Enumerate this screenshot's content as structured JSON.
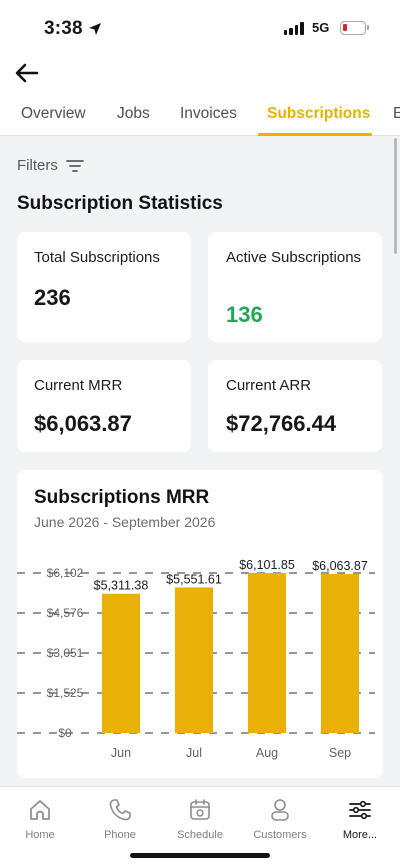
{
  "status_bar": {
    "time": "3:38",
    "network": "5G"
  },
  "tabs": [
    {
      "label": "Overview"
    },
    {
      "label": "Jobs"
    },
    {
      "label": "Invoices"
    },
    {
      "label": "Subscriptions",
      "active": true
    },
    {
      "label": "E"
    }
  ],
  "filters": {
    "label": "Filters"
  },
  "section_title": "Subscription Statistics",
  "stats": {
    "total": {
      "label": "Total Subscriptions",
      "value": "236"
    },
    "active": {
      "label": "Active Subscriptions",
      "value": "136"
    },
    "mrr": {
      "label": "Current MRR",
      "value": "$6,063.87"
    },
    "arr": {
      "label": "Current ARR",
      "value": "$72,766.44"
    }
  },
  "chart": {
    "title": "Subscriptions MRR",
    "subtitle": "June 2026 - September 2026"
  },
  "chart_data": {
    "type": "bar",
    "title": "Subscriptions MRR",
    "subtitle": "June 2026 - September 2026",
    "categories": [
      "Jun",
      "Jul",
      "Aug",
      "Sep"
    ],
    "values": [
      5311.38,
      5551.61,
      6101.85,
      6063.87
    ],
    "value_labels": [
      "$5,311.38",
      "$5,551.61",
      "$6,101.85",
      "$6,063.87"
    ],
    "y_ticks": [
      0,
      1525,
      3051,
      4576,
      6102
    ],
    "y_tick_labels": [
      "$0",
      "$1,525",
      "$3,051",
      "$4,576",
      "$6,102"
    ],
    "ylim": [
      0,
      6102
    ],
    "grid": "dashed",
    "color": "#e9b106"
  },
  "bottom_nav": [
    {
      "label": "Home",
      "icon": "home-icon"
    },
    {
      "label": "Phone",
      "icon": "phone-icon"
    },
    {
      "label": "Schedule",
      "icon": "calendar-icon"
    },
    {
      "label": "Customers",
      "icon": "person-icon"
    },
    {
      "label": "More...",
      "icon": "sliders-icon",
      "active": true
    }
  ],
  "colors": {
    "accent": "#e9b106",
    "positive": "#22a755",
    "low_battery": "#e0242b"
  }
}
